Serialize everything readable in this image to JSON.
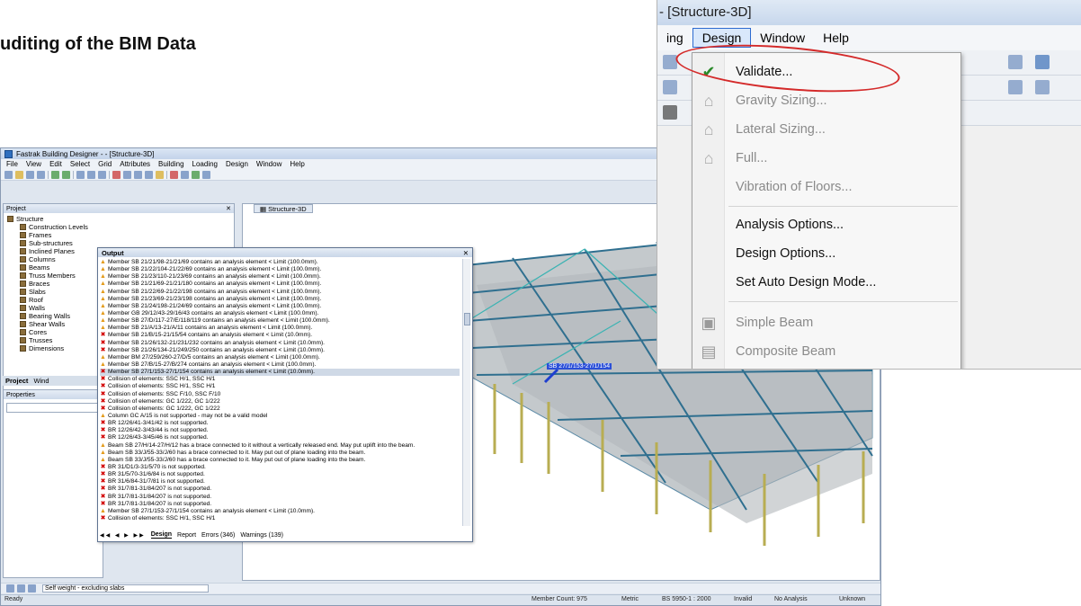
{
  "slide": {
    "title": "uditing of the BIM Data"
  },
  "app": {
    "title": "Fastrak Building Designer - - [Structure-3D]",
    "menu": [
      "File",
      "View",
      "Edit",
      "Select",
      "Grid",
      "Attributes",
      "Building",
      "Loading",
      "Design",
      "Window",
      "Help"
    ],
    "project_panel": {
      "title": "Project",
      "tree": [
        "Structure",
        "Construction Levels",
        "Frames",
        "Sub-structures",
        "Inclined Planes",
        "Columns",
        "Beams",
        "Truss Members",
        "Braces",
        "Slabs",
        "Roof",
        "Walls",
        "Bearing Walls",
        "Shear Walls",
        "Cores",
        "Trusses",
        "Dimensions"
      ],
      "tabs": [
        "Project",
        "Wind"
      ]
    },
    "properties_panel": {
      "title": "Properties"
    },
    "view_tab": "Structure-3D",
    "beam_label": "SB 27/1/153-27/1/154",
    "output": {
      "title": "Output",
      "messages": [
        {
          "type": "warning",
          "text": "Member SB 21/21/98-21/21/69 contains an analysis element < Limit (100.0mm)."
        },
        {
          "type": "warning",
          "text": "Member SB 21/22/104-21/22/69 contains an analysis element < Limit (100.0mm)."
        },
        {
          "type": "warning",
          "text": "Member SB 21/23/110-21/23/69 contains an analysis element < Limit (100.0mm)."
        },
        {
          "type": "warning",
          "text": "Member SB 21/21/69-21/21/180 contains an analysis element < Limit (100.0mm)."
        },
        {
          "type": "warning",
          "text": "Member SB 21/22/69-21/22/198 contains an analysis element < Limit (100.0mm)."
        },
        {
          "type": "warning",
          "text": "Member SB 21/23/69-21/23/198 contains an analysis element < Limit (100.0mm)."
        },
        {
          "type": "warning",
          "text": "Member SB 21/24/198-21/24/69 contains an analysis element < Limit (100.0mm)."
        },
        {
          "type": "warning",
          "text": "Member GB 29/12/43-29/16/43 contains an analysis element < Limit (100.0mm)."
        },
        {
          "type": "warning",
          "text": "Member SB 27/D/117-27/E/118/119 contains an analysis element < Limit (100.0mm)."
        },
        {
          "type": "warning",
          "text": "Member SB 21/A/13-21/A/11 contains an analysis element < Limit (100.0mm)."
        },
        {
          "type": "error",
          "text": "Member SB 21/B/15-21/15/54 contains an analysis element < Limit (10.0mm)."
        },
        {
          "type": "error",
          "text": "Member SB 21/26/132-21/231/232 contains an analysis element < Limit (10.0mm)."
        },
        {
          "type": "error",
          "text": "Member SB 21/26/134-21/249/250 contains an analysis element < Limit (10.0mm)."
        },
        {
          "type": "warning",
          "text": "Member BM 27/259/260-27/D/5 contains an analysis element < Limit (100.0mm)."
        },
        {
          "type": "warning",
          "text": "Member SB 27/B/15-27/B/274 contains an analysis element < Limit (100.0mm)."
        },
        {
          "type": "error",
          "text": "Member SB 27/1/153-27/1/154 contains an analysis element < Limit (10.0mm)."
        },
        {
          "type": "error",
          "text": "Collision of elements: SSC H/1, SSC H/1"
        },
        {
          "type": "error",
          "text": "Collision of elements: SSC H/1, SSC H/1"
        },
        {
          "type": "error",
          "text": "Collision of elements: SSC F/10, SSC F/10"
        },
        {
          "type": "error",
          "text": "Collision of elements: GC 1/222, GC 1/222"
        },
        {
          "type": "error",
          "text": "Collision of elements: GC 1/222, GC 1/222"
        },
        {
          "type": "warning",
          "text": "Column GC A/15 is not supported - may not be a valid model"
        },
        {
          "type": "error",
          "text": "BR 12/26/41-3/41/42 is not supported."
        },
        {
          "type": "error",
          "text": "BR 12/26/42-3/43/44 is not supported."
        },
        {
          "type": "error",
          "text": "BR 12/26/43-3/45/46 is not supported."
        },
        {
          "type": "warning",
          "text": "Beam SB 27/H/14-27/H/12 has a brace connected to it without a vertically released end. May put uplift into the beam."
        },
        {
          "type": "warning",
          "text": "Beam SB 33/J/55-33/J/60 has a brace connected to it. May put out of plane loading into the beam."
        },
        {
          "type": "warning",
          "text": "Beam SB 33/J/55-33/J/60 has a brace connected to it. May put out of plane loading into the beam."
        },
        {
          "type": "error",
          "text": "BR 31/D1/3-31/5/70 is not supported."
        },
        {
          "type": "error",
          "text": "BR 31/5/70-31/6/84 is not supported."
        },
        {
          "type": "error",
          "text": "BR 31/6/84-31/7/81 is not supported."
        },
        {
          "type": "error",
          "text": "BR 31/7/81-31/84/207 is not supported."
        },
        {
          "type": "error",
          "text": "BR 31/7/81-31/84/207 is not supported."
        },
        {
          "type": "error",
          "text": "BR 31/7/81-31/84/207 is not supported."
        },
        {
          "type": "warning",
          "text": "Member SB 27/1/153-27/1/154 contains an analysis element < Limit (10.0mm)."
        },
        {
          "type": "error",
          "text": "Collision of elements: SSC H/1, SSC H/1"
        }
      ],
      "selected_index": 15,
      "tabs": [
        "Design",
        "Report",
        "Errors (346)",
        "Warnings (139)"
      ]
    },
    "load_case": "Self weight - excluding slabs",
    "status": {
      "ready": "Ready",
      "member_count": "Member Count: 975",
      "units": "Metric",
      "code": "BS 5950-1 : 2000",
      "validity": "Invalid",
      "analysis": "No Analysis",
      "design": "Unknown"
    }
  },
  "zoom": {
    "title": "- [Structure-3D]",
    "menu": [
      "ing",
      "Design",
      "Window",
      "Help"
    ],
    "active_menu": "Design",
    "design_menu": [
      {
        "label": "Validate...",
        "icon": "validate-icon",
        "enabled": true
      },
      {
        "label": "Gravity Sizing...",
        "icon": "gravity-sizing-icon",
        "enabled": false
      },
      {
        "label": "Lateral Sizing...",
        "icon": "lateral-sizing-icon",
        "enabled": false
      },
      {
        "label": "Full...",
        "icon": "full-design-icon",
        "enabled": false
      },
      {
        "label": "Vibration of Floors...",
        "icon": "",
        "enabled": false
      },
      {
        "label": "Analysis Options...",
        "icon": "",
        "enabled": true
      },
      {
        "label": "Design Options...",
        "icon": "",
        "enabled": true
      },
      {
        "label": "Set Auto Design Mode...",
        "icon": "",
        "enabled": true
      },
      {
        "label": "Simple Beam",
        "icon": "simple-beam-icon",
        "enabled": false
      },
      {
        "label": "Composite Beam",
        "icon": "composite-beam-icon",
        "enabled": false
      }
    ]
  }
}
